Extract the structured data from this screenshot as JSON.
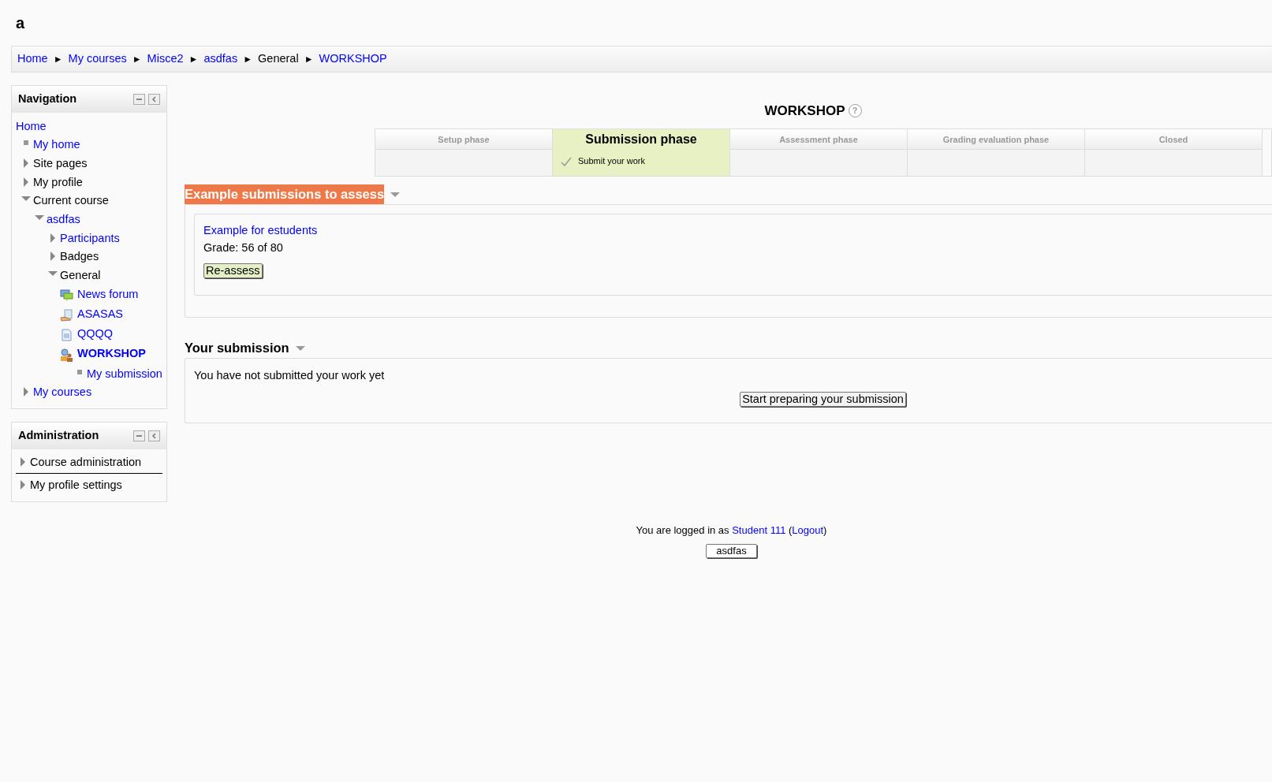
{
  "site_title": "a",
  "breadcrumb": [
    {
      "label": "Home",
      "link": true,
      "separator": "►"
    },
    {
      "label": "My courses",
      "link": true,
      "separator": "►"
    },
    {
      "label": "Misce2",
      "link": true,
      "separator": "►"
    },
    {
      "label": "asdfas",
      "link": true,
      "separator": "►"
    },
    {
      "label": "General",
      "link": false,
      "separator": "►"
    },
    {
      "label": "WORKSHOP",
      "link": true
    }
  ],
  "blocks": [
    {
      "title": "Navigation",
      "items": [
        {
          "label": "Home",
          "link": true,
          "kind": "root",
          "current": false,
          "children": [
            {
              "label": "My home",
              "link": true,
              "kind": "leaf",
              "current": false
            },
            {
              "label": "Site pages",
              "link": false,
              "kind": "branch",
              "expanded": false,
              "current": false
            },
            {
              "label": "My profile",
              "link": false,
              "kind": "branch",
              "expanded": false,
              "current": false
            },
            {
              "label": "Current course",
              "link": false,
              "kind": "branch",
              "expanded": true,
              "current": false,
              "children": [
                {
                  "label": "asdfas",
                  "link": true,
                  "kind": "branch",
                  "expanded": true,
                  "current": false,
                  "children": [
                    {
                      "label": "Participants",
                      "link": true,
                      "kind": "branch",
                      "expanded": false,
                      "current": false
                    },
                    {
                      "label": "Badges",
                      "link": false,
                      "kind": "branch",
                      "expanded": false,
                      "current": false
                    },
                    {
                      "label": "General",
                      "link": false,
                      "kind": "branch",
                      "expanded": true,
                      "current": false,
                      "children": [
                        {
                          "label": "News forum",
                          "link": true,
                          "kind": "forum",
                          "current": false
                        },
                        {
                          "label": "ASASAS",
                          "link": true,
                          "kind": "assignment",
                          "current": false
                        },
                        {
                          "label": "QQQQ",
                          "link": true,
                          "kind": "page",
                          "current": false
                        },
                        {
                          "label": "WORKSHOP",
                          "link": true,
                          "kind": "workshop",
                          "current": true,
                          "children": [
                            {
                              "label": "My submission",
                              "link": true,
                              "kind": "leaf",
                              "current": false
                            }
                          ]
                        }
                      ]
                    }
                  ]
                }
              ]
            },
            {
              "label": "My courses",
              "link": true,
              "kind": "branch",
              "expanded": false,
              "current": false
            }
          ]
        }
      ]
    },
    {
      "title": "Administration",
      "items": [
        {
          "label": "Course administration",
          "link": false,
          "kind": "branch",
          "expanded": false,
          "current": false
        },
        {
          "label": "My profile settings",
          "link": false,
          "kind": "branch",
          "expanded": false,
          "current": false
        }
      ]
    }
  ],
  "page_title": "WORKSHOP",
  "help": "?",
  "phases": [
    {
      "name": "Setup phase",
      "selected": false
    },
    {
      "name": "Submission phase",
      "selected": true,
      "tasks": [
        "Submit your work"
      ]
    },
    {
      "name": "Assessment phase",
      "selected": false
    },
    {
      "name": "Grading evaluation phase",
      "selected": false
    },
    {
      "name": "Closed",
      "selected": false
    }
  ],
  "sections": [
    {
      "kind": "examples",
      "title": "Example submissions to assess",
      "highlighted": true,
      "examples": [
        {
          "title": "Example for estudents",
          "grade": "Grade: 56 of 80",
          "button": "Re-assess"
        }
      ]
    },
    {
      "kind": "submission",
      "title": "Your submission",
      "highlighted": false,
      "message": "You have not submitted your work yet",
      "button": "Start preparing your submission"
    }
  ],
  "footer": {
    "login_parts": [
      {
        "text": "You are logged in as ",
        "link": false
      },
      {
        "text": "Student 111",
        "link": true
      },
      {
        "text": " (",
        "link": false
      },
      {
        "text": "Logout",
        "link": true
      },
      {
        "text": ")",
        "link": false
      }
    ],
    "home_button": "asdfas"
  }
}
